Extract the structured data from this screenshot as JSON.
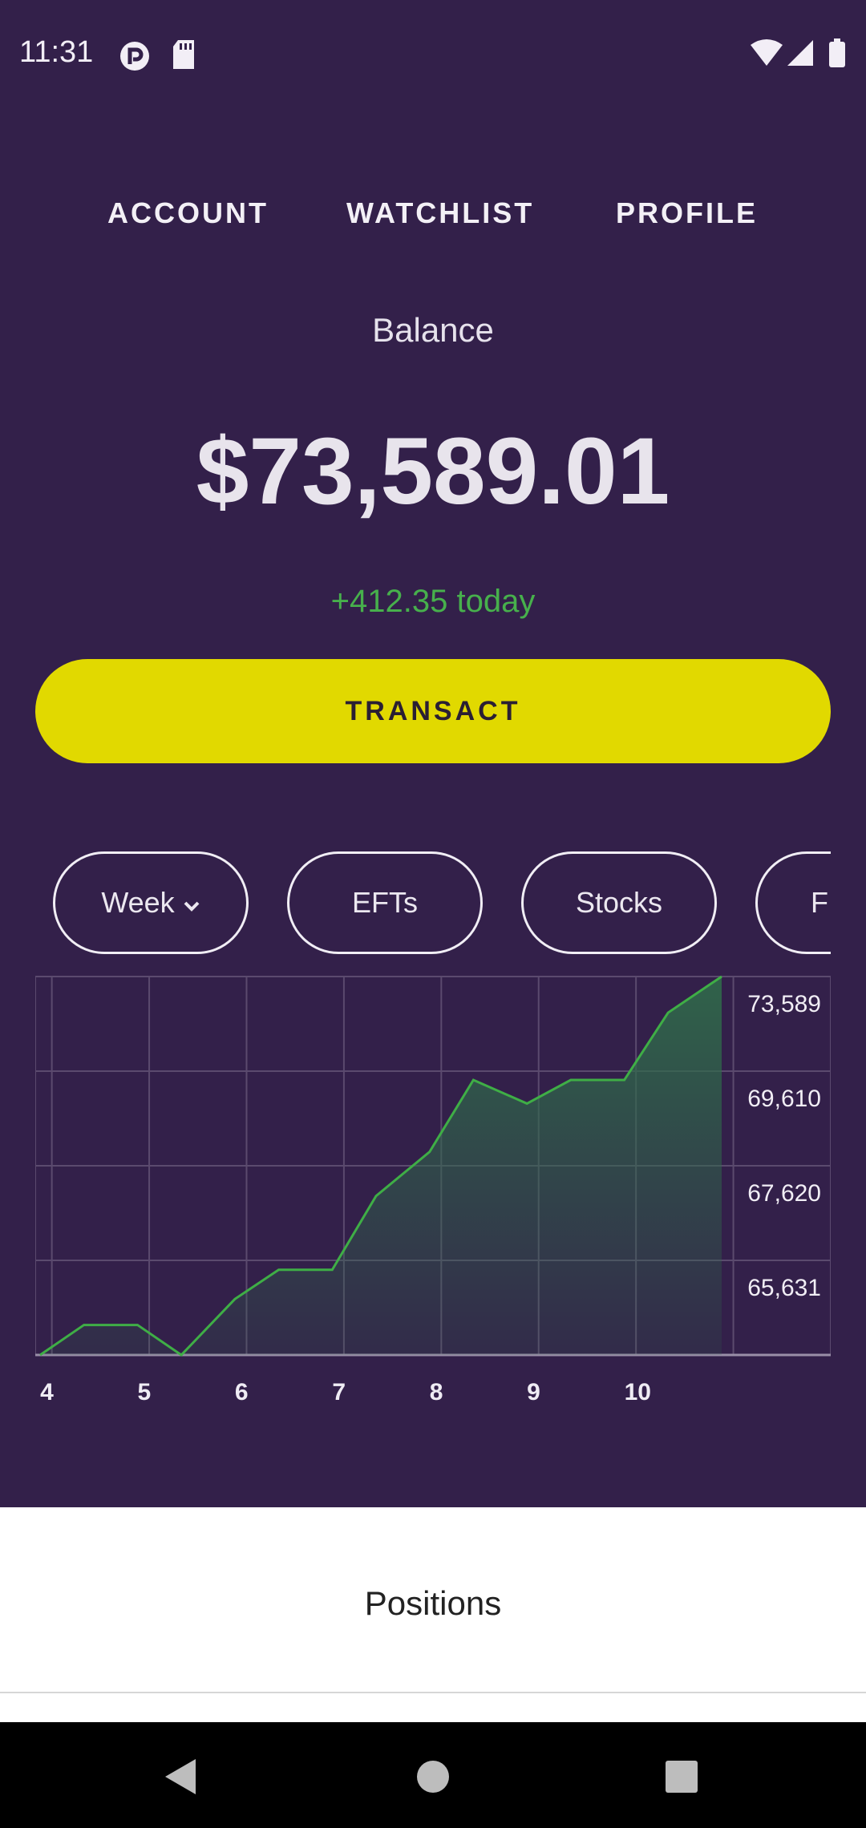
{
  "status_bar": {
    "time": "11:31",
    "icons": [
      "pocket-casts-icon",
      "sd-card-icon",
      "wifi-icon",
      "signal-icon",
      "battery-icon"
    ]
  },
  "nav": {
    "tabs": [
      {
        "label": "ACCOUNT"
      },
      {
        "label": "WATCHLIST"
      },
      {
        "label": "PROFILE"
      }
    ]
  },
  "balance": {
    "label": "Balance",
    "value": "$73,589.01",
    "change": "+412.35 today"
  },
  "transact_label": "TRANSACT",
  "filters": [
    {
      "label": "Week",
      "has_dropdown": true
    },
    {
      "label": "EFTs"
    },
    {
      "label": "Stocks"
    },
    {
      "label": "F"
    }
  ],
  "chart_data": {
    "type": "area",
    "x_tick_labels": [
      "4",
      "5",
      "6",
      "7",
      "8",
      "9",
      "10"
    ],
    "y_tick_labels": [
      "73,589",
      "69,610",
      "67,620",
      "65,631"
    ],
    "y_ticks": [
      73589,
      69610,
      67620,
      65631
    ],
    "ylim": [
      63641,
      73589
    ],
    "x": [
      4.0,
      4.45,
      5.0,
      5.45,
      6.0,
      6.45,
      7.0,
      7.45,
      8.0,
      8.45,
      9.0,
      9.45,
      10.0,
      10.45,
      11.0
    ],
    "values": [
      63641,
      64430,
      64430,
      63641,
      65110,
      65880,
      65880,
      67820,
      68980,
      70870,
      70250,
      70870,
      70870,
      72640,
      73589
    ],
    "line_color": "#3fae46",
    "fill_color": "#2f6a4a",
    "grid": true
  },
  "positions_label": "Positions",
  "system_nav": [
    "back-icon",
    "home-icon",
    "recents-icon"
  ]
}
